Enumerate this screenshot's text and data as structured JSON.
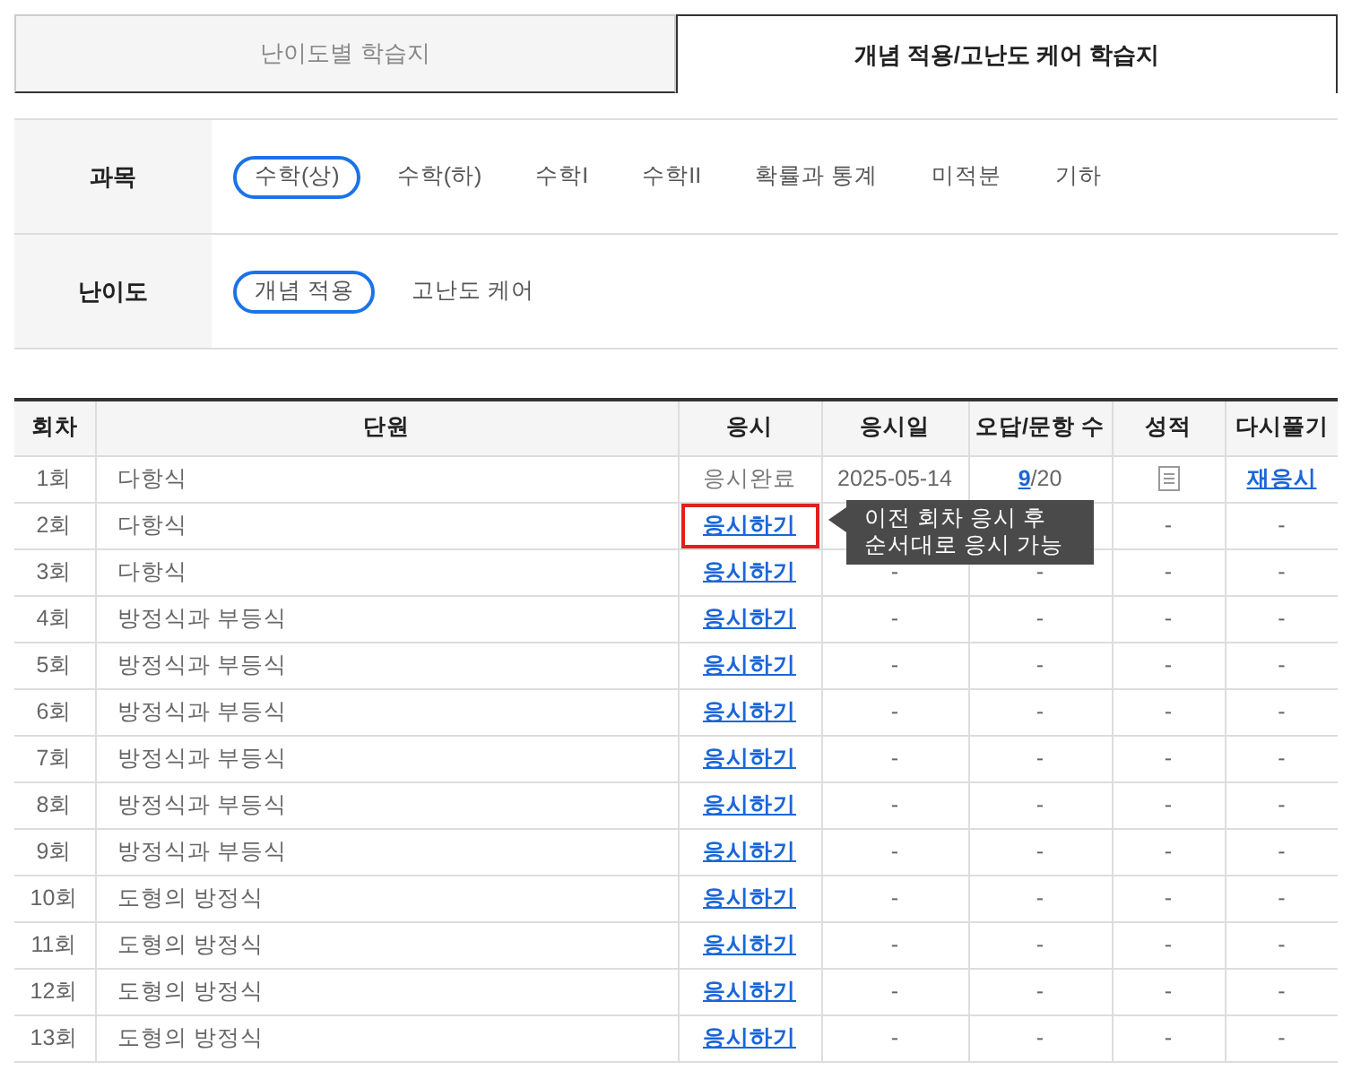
{
  "tabs": [
    {
      "label": "난이도별 학습지",
      "selected": false
    },
    {
      "label": "개념 적용/고난도 케어 학습지",
      "selected": true
    }
  ],
  "filters": [
    {
      "label": "과목",
      "options": [
        {
          "label": "수학(상)",
          "selected": true
        },
        {
          "label": "수학(하)",
          "selected": false
        },
        {
          "label": "수학I",
          "selected": false
        },
        {
          "label": "수학II",
          "selected": false
        },
        {
          "label": "확률과 통계",
          "selected": false
        },
        {
          "label": "미적분",
          "selected": false
        },
        {
          "label": "기하",
          "selected": false
        }
      ]
    },
    {
      "label": "난이도",
      "options": [
        {
          "label": "개념 적용",
          "selected": true
        },
        {
          "label": "고난도 케어",
          "selected": false
        }
      ]
    }
  ],
  "table": {
    "columns": [
      "회차",
      "단원",
      "응시",
      "응시일",
      "오답/문항 수",
      "성적",
      "다시풀기"
    ],
    "rows": [
      {
        "round": "1회",
        "unit": "다항식",
        "action": {
          "kind": "status",
          "text": "응시완료",
          "highlighted": false
        },
        "date": "2025-05-14",
        "score": {
          "kind": "link",
          "wrong": "9",
          "total": "/20"
        },
        "grade": {
          "kind": "icon"
        },
        "retry": {
          "kind": "link",
          "text": "재응시"
        }
      },
      {
        "round": "2회",
        "unit": "다항식",
        "action": {
          "kind": "link",
          "text": "응시하기",
          "highlighted": true
        },
        "grade": {
          "kind": "text",
          "text": "-"
        },
        "retry": {
          "kind": "text",
          "text": "-"
        }
      },
      {
        "round": "3회",
        "unit": "다항식",
        "action": {
          "kind": "link",
          "text": "응시하기",
          "highlighted": false
        },
        "date": "-",
        "score": {
          "kind": "text",
          "text": "-"
        },
        "grade": {
          "kind": "text",
          "text": "-"
        },
        "retry": {
          "kind": "text",
          "text": "-"
        }
      },
      {
        "round": "4회",
        "unit": "방정식과 부등식",
        "action": {
          "kind": "link",
          "text": "응시하기",
          "highlighted": false
        },
        "date": "-",
        "score": {
          "kind": "text",
          "text": "-"
        },
        "grade": {
          "kind": "text",
          "text": "-"
        },
        "retry": {
          "kind": "text",
          "text": "-"
        }
      },
      {
        "round": "5회",
        "unit": "방정식과 부등식",
        "action": {
          "kind": "link",
          "text": "응시하기",
          "highlighted": false
        },
        "date": "-",
        "score": {
          "kind": "text",
          "text": "-"
        },
        "grade": {
          "kind": "text",
          "text": "-"
        },
        "retry": {
          "kind": "text",
          "text": "-"
        }
      },
      {
        "round": "6회",
        "unit": "방정식과 부등식",
        "action": {
          "kind": "link",
          "text": "응시하기",
          "highlighted": false
        },
        "date": "-",
        "score": {
          "kind": "text",
          "text": "-"
        },
        "grade": {
          "kind": "text",
          "text": "-"
        },
        "retry": {
          "kind": "text",
          "text": "-"
        }
      },
      {
        "round": "7회",
        "unit": "방정식과 부등식",
        "action": {
          "kind": "link",
          "text": "응시하기",
          "highlighted": false
        },
        "date": "-",
        "score": {
          "kind": "text",
          "text": "-"
        },
        "grade": {
          "kind": "text",
          "text": "-"
        },
        "retry": {
          "kind": "text",
          "text": "-"
        }
      },
      {
        "round": "8회",
        "unit": "방정식과 부등식",
        "action": {
          "kind": "link",
          "text": "응시하기",
          "highlighted": false
        },
        "date": "-",
        "score": {
          "kind": "text",
          "text": "-"
        },
        "grade": {
          "kind": "text",
          "text": "-"
        },
        "retry": {
          "kind": "text",
          "text": "-"
        }
      },
      {
        "round": "9회",
        "unit": "방정식과 부등식",
        "action": {
          "kind": "link",
          "text": "응시하기",
          "highlighted": false
        },
        "date": "-",
        "score": {
          "kind": "text",
          "text": "-"
        },
        "grade": {
          "kind": "text",
          "text": "-"
        },
        "retry": {
          "kind": "text",
          "text": "-"
        }
      },
      {
        "round": "10회",
        "unit": "도형의 방정식",
        "action": {
          "kind": "link",
          "text": "응시하기",
          "highlighted": false
        },
        "date": "-",
        "score": {
          "kind": "text",
          "text": "-"
        },
        "grade": {
          "kind": "text",
          "text": "-"
        },
        "retry": {
          "kind": "text",
          "text": "-"
        }
      },
      {
        "round": "11회",
        "unit": "도형의 방정식",
        "action": {
          "kind": "link",
          "text": "응시하기",
          "highlighted": false
        },
        "date": "-",
        "score": {
          "kind": "text",
          "text": "-"
        },
        "grade": {
          "kind": "text",
          "text": "-"
        },
        "retry": {
          "kind": "text",
          "text": "-"
        }
      },
      {
        "round": "12회",
        "unit": "도형의 방정식",
        "action": {
          "kind": "link",
          "text": "응시하기",
          "highlighted": false
        },
        "date": "-",
        "score": {
          "kind": "text",
          "text": "-"
        },
        "grade": {
          "kind": "text",
          "text": "-"
        },
        "retry": {
          "kind": "text",
          "text": "-"
        }
      },
      {
        "round": "13회",
        "unit": "도형의 방정식",
        "action": {
          "kind": "link",
          "text": "응시하기",
          "highlighted": false
        },
        "date": "-",
        "score": {
          "kind": "text",
          "text": "-"
        },
        "grade": {
          "kind": "text",
          "text": "-"
        },
        "retry": {
          "kind": "text",
          "text": "-"
        }
      }
    ]
  },
  "tooltip": {
    "lines": [
      "이전 회차 응시 후",
      "순서대로 응시 가능"
    ]
  }
}
